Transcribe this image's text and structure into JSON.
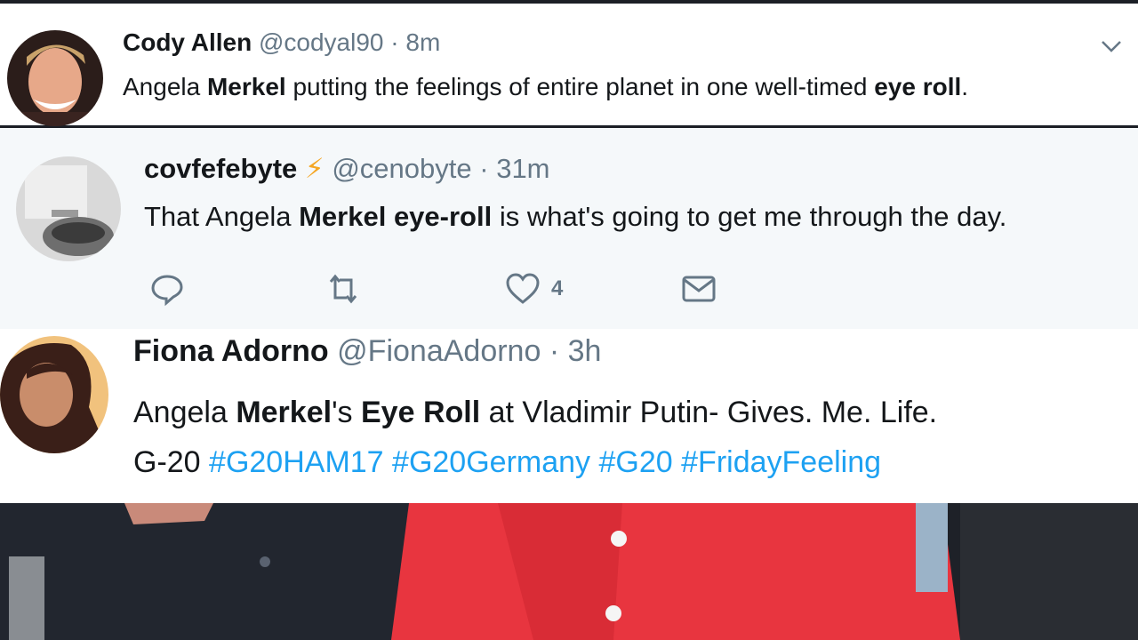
{
  "tweets": [
    {
      "name": "Cody Allen",
      "handle": "@codyal90",
      "separator": "·",
      "time": "8m",
      "text_parts": [
        "Angela ",
        "Merkel",
        " putting the feelings of entire planet in one well-timed ",
        "eye roll",
        "."
      ]
    },
    {
      "name": "covfefebyte",
      "name_emoji": "⚡",
      "handle": "@cenobyte",
      "separator": "·",
      "time": "31m",
      "text_parts": [
        "That Angela ",
        "Merkel",
        " ",
        "eye-roll",
        " is what's going to get me through the day."
      ],
      "like_count": "4"
    },
    {
      "name": "Fiona Adorno",
      "handle": "@FionaAdorno",
      "separator": "·",
      "time": "3h",
      "line1_parts": [
        "Angela ",
        "Merkel",
        "'s ",
        "Eye Roll",
        " at Vladimir Putin- Gives. Me. Life."
      ],
      "line2_prefix": "G-20 ",
      "hashtags": [
        "#G20HAM17",
        "#G20Germany",
        "#G20",
        "#FridayFeeling"
      ]
    }
  ],
  "icons": {
    "chevron": "chevron-down-icon",
    "reply": "reply-icon",
    "retweet": "retweet-icon",
    "like": "heart-icon",
    "dm": "envelope-icon"
  },
  "colors": {
    "hashtag": "#1da1f2",
    "secondary_text": "#657786",
    "coat": "#e8353f"
  }
}
